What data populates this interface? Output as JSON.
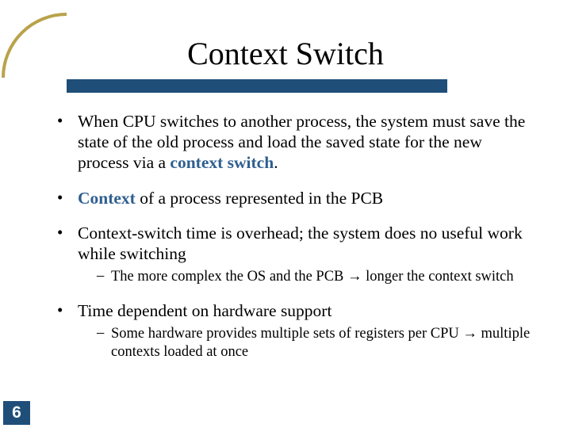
{
  "title": "Context Switch",
  "page_number": "6",
  "colors": {
    "accent": "#1f4e79",
    "highlight": "#2f5f8f"
  },
  "bullets": {
    "b1": {
      "pre": "When CPU switches to another process, the system must save the state of the old process and load the saved state for the new process via a ",
      "hl": "context switch",
      "post": "."
    },
    "b2": {
      "hl": "Context",
      "post": " of a process represented in the PCB"
    },
    "b3": {
      "text": "Context-switch time is overhead; the system does no useful work while switching",
      "sub1_pre": "The more complex the OS and the PCB ",
      "sub1_arrow": "→",
      "sub1_post": " longer the context switch"
    },
    "b4": {
      "text": "Time dependent on hardware support",
      "sub1_pre": "Some hardware provides multiple sets of registers per CPU ",
      "sub1_arrow": "→",
      "sub1_post": " multiple contexts loaded at once"
    }
  }
}
